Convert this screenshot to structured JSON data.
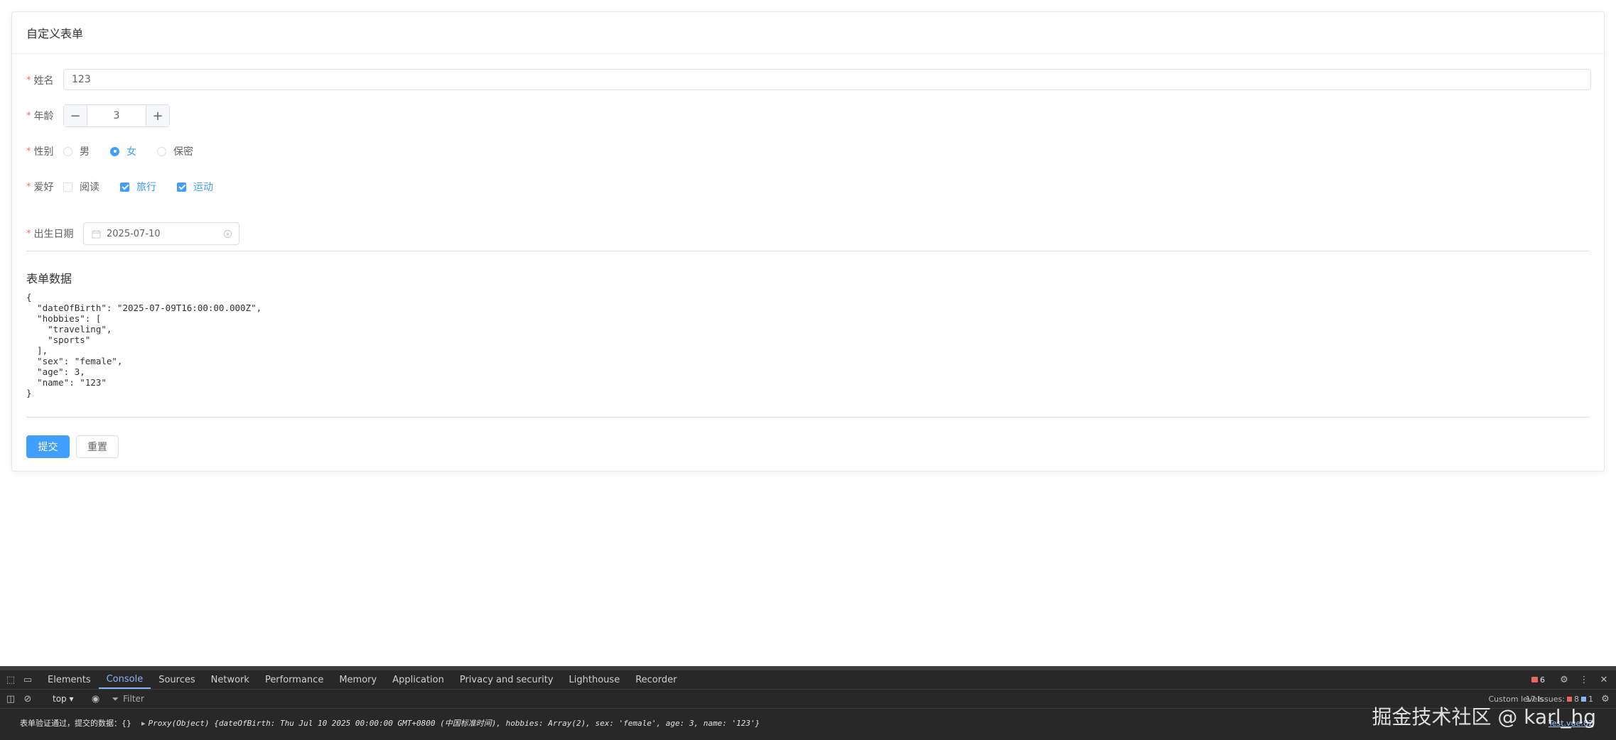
{
  "card": {
    "title": "自定义表单"
  },
  "form": {
    "name": {
      "label": "姓名",
      "value": "123"
    },
    "age": {
      "label": "年龄",
      "value": "3",
      "minus": "−",
      "plus": "+"
    },
    "sex": {
      "label": "性别",
      "options": [
        "男",
        "女",
        "保密"
      ],
      "selected": "女"
    },
    "hobbies": {
      "label": "爱好",
      "options": [
        "阅读",
        "旅行",
        "运动"
      ],
      "checked": [
        "旅行",
        "运动"
      ]
    },
    "birth": {
      "label": "出生日期",
      "value": "2025-07-10"
    }
  },
  "data_section": {
    "title": "表单数据",
    "json": "{\n  \"dateOfBirth\": \"2025-07-09T16:00:00.000Z\",\n  \"hobbies\": [\n    \"traveling\",\n    \"sports\"\n  ],\n  \"sex\": \"female\",\n  \"age\": 3,\n  \"name\": \"123\"\n}"
  },
  "buttons": {
    "submit": "提交",
    "reset": "重置"
  },
  "devtools": {
    "tabs": [
      "Elements",
      "Console",
      "Sources",
      "Network",
      "Performance",
      "Memory",
      "Application",
      "Privacy and security",
      "Lighthouse",
      "Recorder"
    ],
    "active_tab": "Console",
    "context": "top",
    "filter_placeholder": "Filter",
    "error_count": "6",
    "levels_label": "Custom levels",
    "issues_label": "17 Issues:",
    "issues_error": "8",
    "issues_info": "1",
    "log_message": "表单验证通过，提交的数据：{}",
    "log_object": "Proxy(Object) {dateOfBirth: Thu Jul 10 2025 00:00:00 GMT+0800 (中国标准时间), hobbies: Array(2), sex: 'female', age: 3, name: '123'}",
    "log_source": "Test.vue:82"
  },
  "watermark": "掘金技术社区 @ karl_hg",
  "colors": {
    "primary": "#409eff",
    "required": "#f56c6c",
    "devtools_bg": "#282828"
  }
}
